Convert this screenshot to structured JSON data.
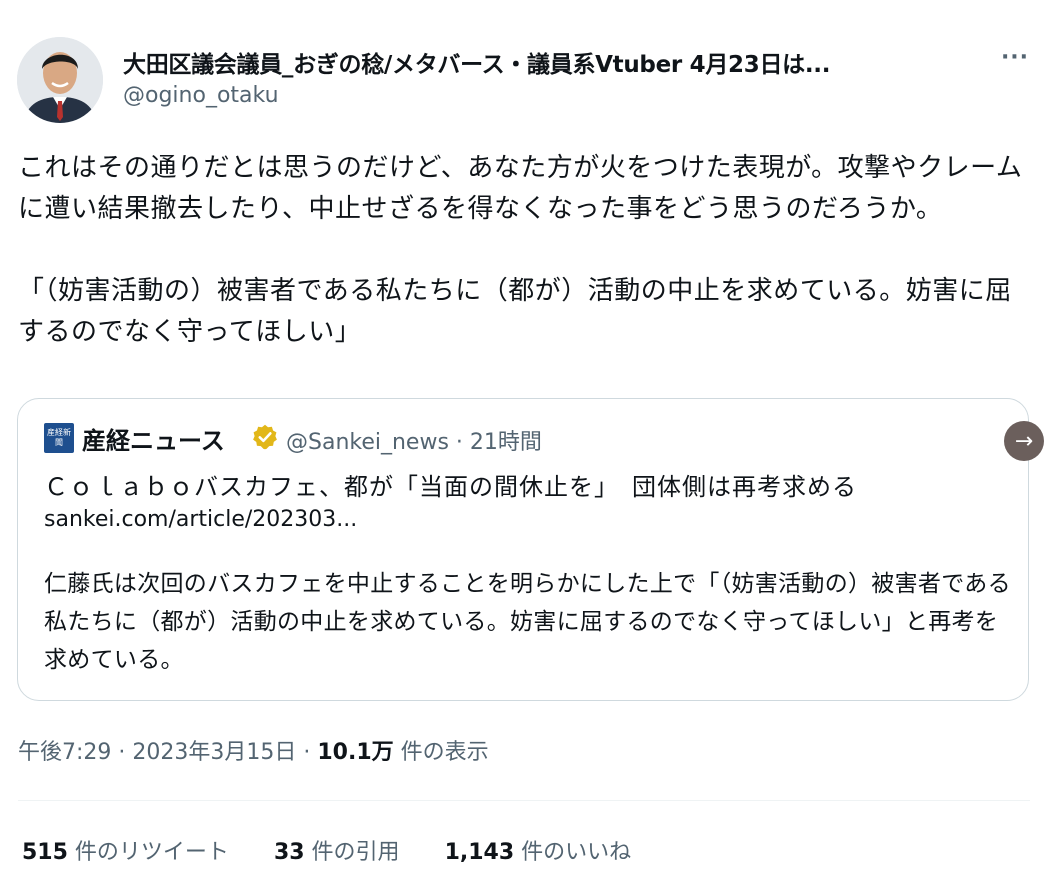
{
  "author": {
    "display_name": "大田区議会議員_おぎの稔/メタバース・議員系Vtuber 4月23日は...",
    "handle": "@ogino_otaku"
  },
  "more_label": "···",
  "tweet": {
    "text": "これはその通りだとは思うのだけど、あなた方が火をつけた表現が。攻撃やクレームに遭い結果撤去したり、中止せざるを得なくなった事をどう思うのだろうか。\n\n「（妨害活動の）被害者である私たちに（都が）活動の中止を求めている。妨害に屈するのでなく守ってほしい」"
  },
  "quote": {
    "source_icon_text": "産経新聞",
    "source_name": "産経ニュース",
    "source_handle": "@Sankei_news · 21時間",
    "title": "Ｃｏｌａｂｏバスカフェ、都が「当面の間休止を」　団体側は再考求める",
    "link": "sankei.com/article/202303...",
    "excerpt": "仁藤氏は次回のバスカフェを中止することを明らかにした上で「（妨害活動の）被害者である私たちに（都が）活動の中止を求めている。妨害に屈するのでなく守ってほしい」と再考を求めている。"
  },
  "meta": {
    "time_date": "午後7:29 · 2023年3月15日 · ",
    "views_count": "10.1万",
    "views_label": " 件の表示"
  },
  "stats": {
    "retweets_count": "515",
    "retweets_label": " 件のリツイート",
    "quotes_count": "33",
    "quotes_label": " 件の引用",
    "likes_count": "1,143",
    "likes_label": " 件のいいね"
  },
  "colors": {
    "text_primary": "#0f1419",
    "text_secondary": "#536471",
    "border": "#cfd9de",
    "verified_gold": "#e2b719",
    "next_button": "#6b5f5c"
  },
  "icons": {
    "avatar": "profile-photo",
    "verified": "verified-badge-icon",
    "next": "arrow-right-icon"
  }
}
